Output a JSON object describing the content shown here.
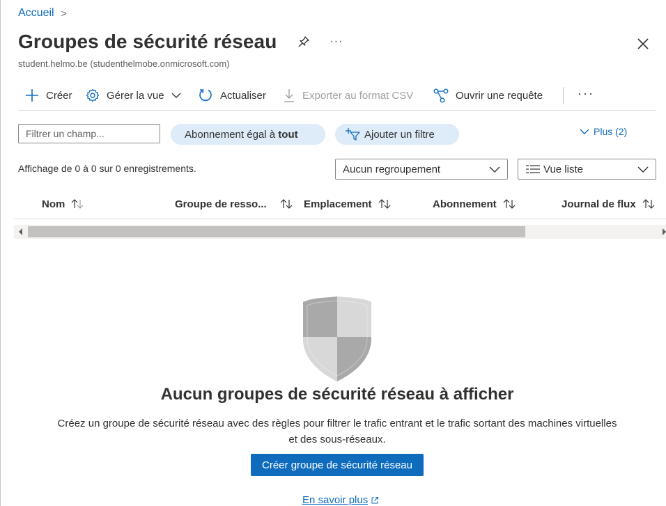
{
  "breadcrumb": {
    "home": "Accueil",
    "separator": ">"
  },
  "header": {
    "title": "Groupes de sécurité réseau",
    "more": "···",
    "subtitle": "student.helmo.be (studenthelmobe.onmicrosoft.com)"
  },
  "toolbar": {
    "create": "Créer",
    "manage_view": "Gérer la vue",
    "refresh": "Actualiser",
    "export_csv": "Exporter au format CSV",
    "open_query": "Ouvrir une requête",
    "more": "···"
  },
  "filters": {
    "placeholder": "Filtrer un champ...",
    "subscription_prefix": "Abonnement égal à ",
    "subscription_value": "tout",
    "add_filter": "Ajouter un filtre",
    "more": "Plus (2)"
  },
  "list": {
    "record_count": "Affichage de 0 à 0 sur 0 enregistrements.",
    "grouping": "Aucun regroupement",
    "view": "Vue liste",
    "columns": [
      "Nom",
      "Groupe de resso...",
      "Emplacement",
      "Abonnement",
      "Journal de flux"
    ]
  },
  "empty_state": {
    "title": "Aucun groupes de sécurité réseau à afficher",
    "description": "Créez un groupe de sécurité réseau avec des règles pour filtrer le trafic entrant et le trafic sortant des machines virtuelles et des sous-réseaux.",
    "create_button": "Créer groupe de sécurité réseau",
    "learn_more": "En savoir plus"
  },
  "colors": {
    "accent": "#0f6cbd",
    "pill_bg": "#deecf9",
    "text": "#323130",
    "muted": "#605e5c"
  }
}
